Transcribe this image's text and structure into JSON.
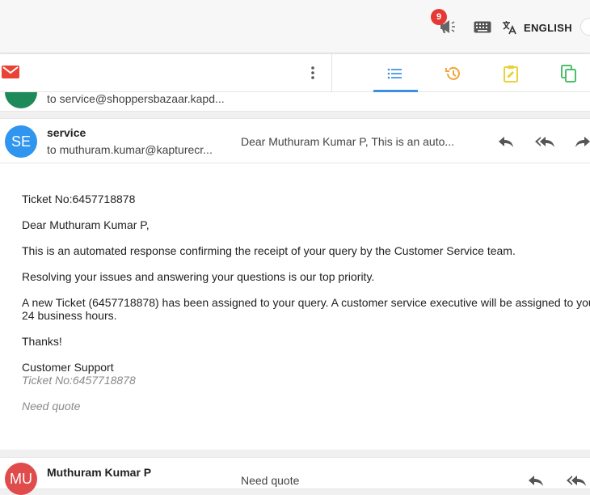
{
  "topbar": {
    "notification_count": "9",
    "language_label": "ENGLISH"
  },
  "previous_message": {
    "to": "to service@shoppersbazaar.kapd..."
  },
  "message": {
    "avatar_initials": "SE",
    "sender": "service",
    "to": "to muthuram.kumar@kapturecr...",
    "snippet": "Dear Muthuram Kumar P, This is an auto...",
    "body": {
      "ticket_line": "Ticket No:6457718878",
      "greeting": "Dear Muthuram Kumar P,",
      "para1": "This is an automated response confirming the receipt of your query by the Customer Service team.",
      "para2": "Resolving your issues and answering your questions is our top priority.",
      "para3_line1": "A new Ticket (6457718878) has been assigned to your query. A customer service executive will be assigned to you",
      "para3_line2": "24 business hours.",
      "thanks": "Thanks!",
      "signature": "Customer Support",
      "quoted_ticket": "Ticket No:6457718878",
      "quoted_text": "Need quote"
    }
  },
  "next_message": {
    "avatar_initials": "MU",
    "sender": "Muthuram Kumar P",
    "snippet": "Need quote"
  },
  "colors": {
    "accent": "#3d8fe0",
    "badge": "#e53935",
    "gmail_red": "#ea4335",
    "history_orange": "#f0a53a",
    "notes_yellow": "#e8d23a",
    "copy_green": "#4cbf6b"
  }
}
